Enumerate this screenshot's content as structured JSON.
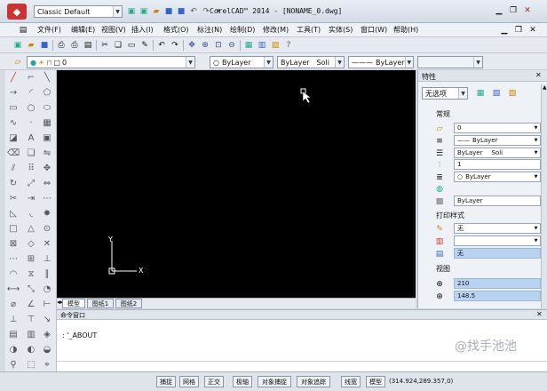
{
  "title": {
    "style_combo": "Classic Default",
    "window_title": "CorelCAD™ 2014 - [NONAME_0.dwg]"
  },
  "menu": [
    "文件(F)",
    "编辑(E)",
    "视图(V)",
    "插入(I)",
    "格式(O)",
    "标注(N)",
    "绘制(D)",
    "修改(M)",
    "工具(T)",
    "实体(S)",
    "窗口(W)",
    "帮助(H)"
  ],
  "layer": {
    "value": "0"
  },
  "props_toolbar": {
    "color": "ByLayer",
    "linetype": "ByLayer",
    "linetype_suffix": "Soli",
    "lineweight": "ByLayer"
  },
  "canvas": {
    "axis_x": "X",
    "axis_y": "Y"
  },
  "layout_tabs": [
    "模型",
    "图纸1",
    "图纸2"
  ],
  "properties": {
    "panel_title": "特性",
    "selection": "无选项",
    "general_title": "常规",
    "layer": "0",
    "color": "ByLayer",
    "linetype": "ByLayer",
    "linetype_suffix": "Soli",
    "scale": "1",
    "lineweight": "ByLayer",
    "transparency": "ByLayer",
    "plotstyle_title": "打印样式",
    "plot_style": "无",
    "plot_table": "",
    "plot_value": "无",
    "view_title": "视图",
    "view_x": "210",
    "view_y": "148.5"
  },
  "command": {
    "title": "命令窗口",
    "line": ": '_ABOUT"
  },
  "status": {
    "buttons": [
      "捕捉",
      "网格",
      "正交",
      "极轴",
      "对象捕捉",
      "对象追踪",
      "线宽",
      "模型"
    ],
    "coords": "(314.924,289.357,0)"
  },
  "watermark": "@找手池池"
}
